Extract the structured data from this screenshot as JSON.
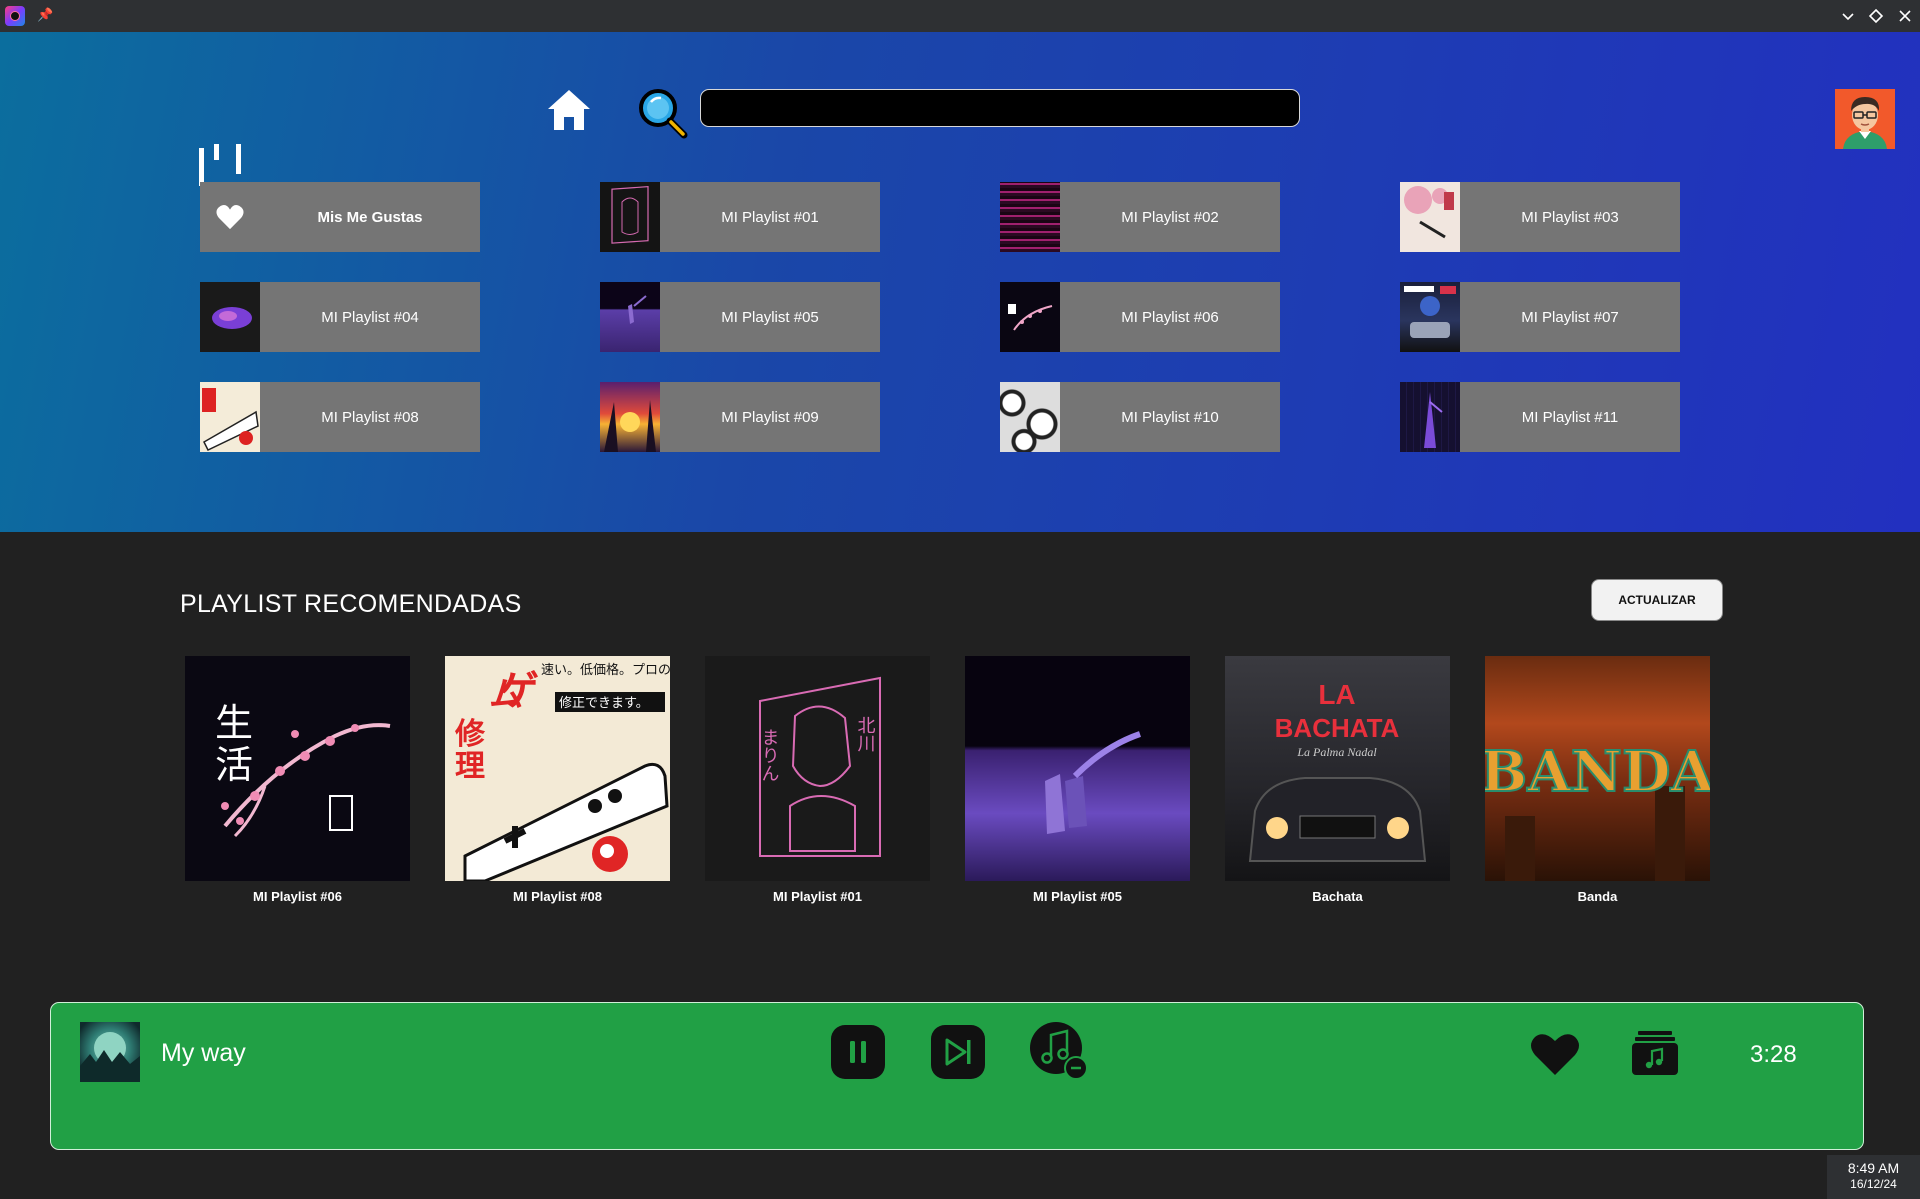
{
  "search": {
    "placeholder": "",
    "value": ""
  },
  "grid": [
    {
      "label": "Mis Me Gustas",
      "icon": "heart-icon"
    },
    {
      "label": "MI Playlist  #01"
    },
    {
      "label": "MI Playlist  #02"
    },
    {
      "label": "MI Playlist  #03"
    },
    {
      "label": "MI Playlist  #04"
    },
    {
      "label": "MI Playlist  #05"
    },
    {
      "label": "MI Playlist  #06"
    },
    {
      "label": "MI Playlist  #07"
    },
    {
      "label": "MI Playlist  #08"
    },
    {
      "label": "MI Playlist  #09"
    },
    {
      "label": "MI Playlist  #10"
    },
    {
      "label": "MI Playlist  #11"
    }
  ],
  "recommended": {
    "title": "PLAYLIST RECOMENDADAS",
    "refresh_label": "ACTUALIZAR",
    "cards": [
      {
        "label": "MI Playlist #06",
        "cover_text": [
          "生",
          "活"
        ]
      },
      {
        "label": "MI Playlist #08",
        "cover_text": [
          "ゲ",
          "ム",
          "修",
          "理",
          "速い。低価格。プロの。",
          "修正できます。"
        ]
      },
      {
        "label": "MI Playlist #01",
        "cover_text": [
          "まりん",
          "北川"
        ]
      },
      {
        "label": "MI Playlist #05"
      },
      {
        "label": "Bachata",
        "cover_text": [
          "LA",
          "BACHATA",
          "La Palma Nadal"
        ]
      },
      {
        "label": "Banda",
        "cover_text": [
          "BANDA"
        ]
      }
    ]
  },
  "player": {
    "track_title": "My way",
    "time": "3:28",
    "colors": {
      "background": "#21a045",
      "buttons": "#111111"
    }
  },
  "clock": {
    "time": "8:49 AM",
    "date": "16/12/24"
  }
}
